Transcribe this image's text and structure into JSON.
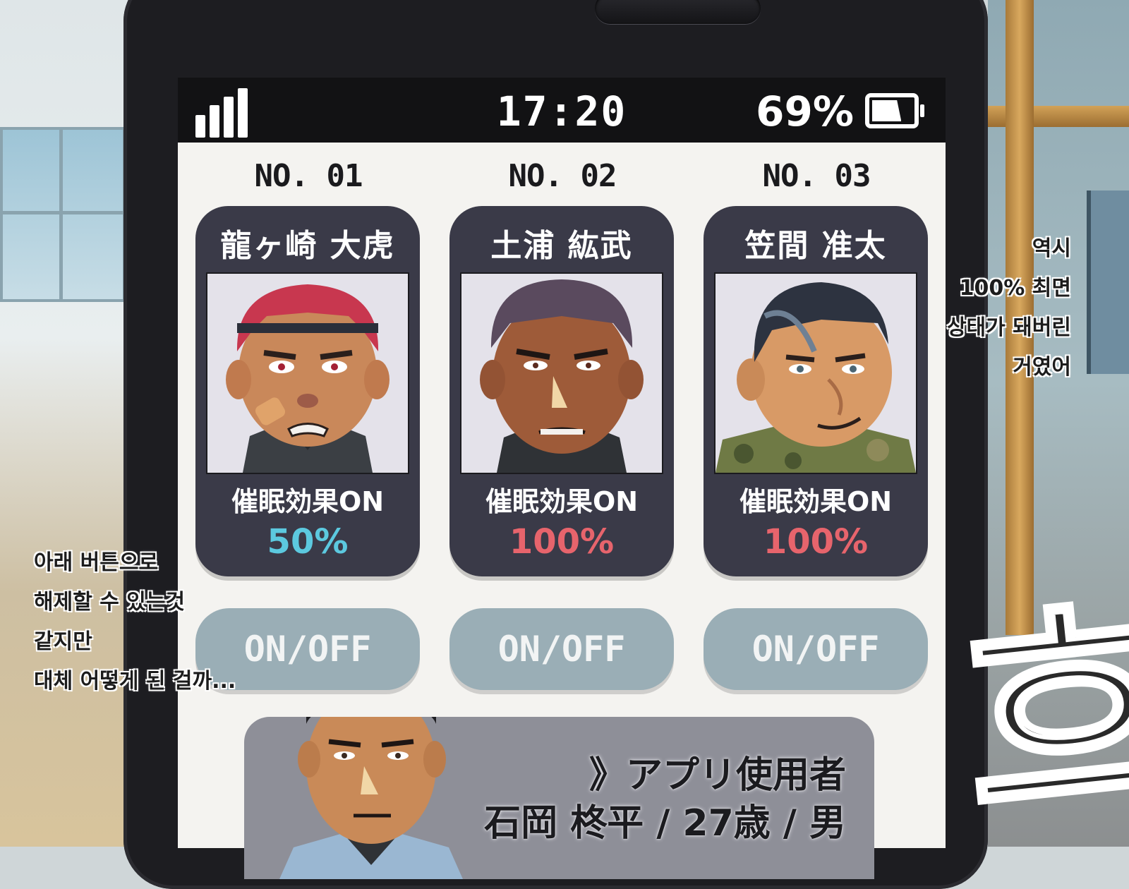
{
  "status_bar": {
    "time": "17:20",
    "battery_percent": "69%",
    "battery_level": 0.69,
    "signal_bars": 4
  },
  "cards": [
    {
      "number": "NO. 01",
      "name": "龍ヶ崎 大虎",
      "effect_label": "催眠効果ON",
      "effect_value": "50%",
      "effect_color": "#5cc9df",
      "hair_color": "#c8374f",
      "toggle_label": "ON/OFF"
    },
    {
      "number": "NO. 02",
      "name": "土浦 紘武",
      "effect_label": "催眠効果ON",
      "effect_value": "100%",
      "effect_color": "#e7646c",
      "hair_color": "#5a4a5e",
      "toggle_label": "ON/OFF"
    },
    {
      "number": "NO. 03",
      "name": "笠間 准太",
      "effect_label": "催眠効果ON",
      "effect_value": "100%",
      "effect_color": "#e7646c",
      "hair_color": "#2d3340",
      "toggle_label": "ON/OFF"
    }
  ],
  "app_user": {
    "role": "》アプリ使用者",
    "info": "石岡 柊平 / 27歳 / 男"
  },
  "captions": {
    "left": [
      "아래 버튼으로",
      "해제할 수 있는것",
      "같지만",
      "대체 어떻게 된 걸까..."
    ],
    "right": [
      "역시",
      "100% 최면",
      "상태가 돼버린",
      "거였어"
    ]
  },
  "sound_effect": "흐",
  "colors": {
    "card_bg": "#3a3a48",
    "toggle_bg": "#9aaeb6",
    "screen_bg": "#f4f3f0"
  }
}
